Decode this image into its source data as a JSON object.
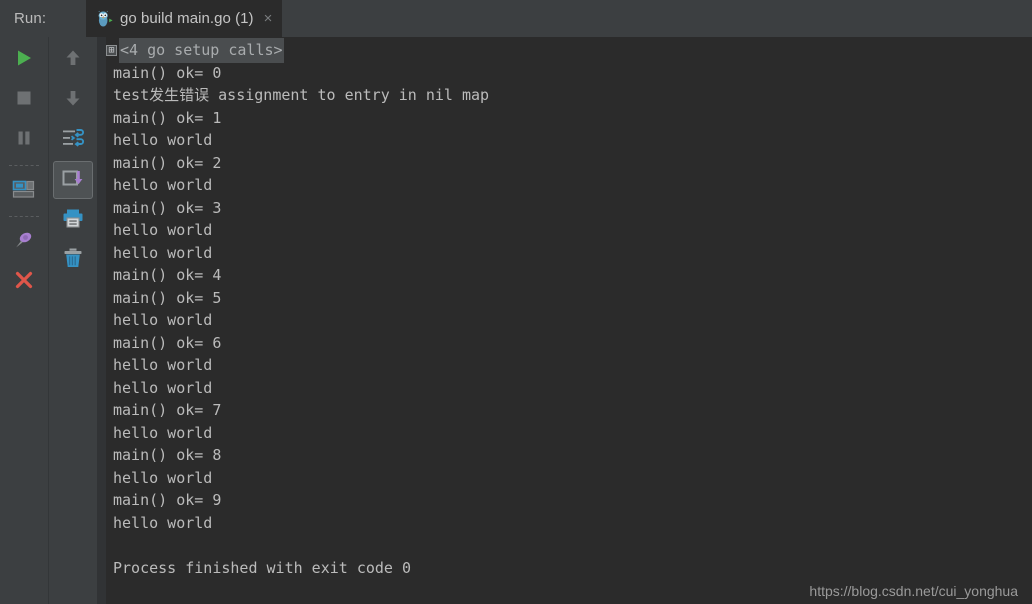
{
  "header": {
    "run_label": "Run:",
    "tab": {
      "title": "go build main.go (1)",
      "icon": "go-gopher-icon",
      "close_label": "×"
    }
  },
  "toolbar_left": [
    {
      "name": "rerun-button",
      "icon": "play-icon",
      "label": "Rerun",
      "color": "#4caf50"
    },
    {
      "name": "stop-button",
      "icon": "stop-square-icon",
      "label": "Stop",
      "color": "#6e7173"
    },
    {
      "name": "pause-button",
      "icon": "pause-icon",
      "label": "Pause Output",
      "color": "#6e7173"
    },
    {
      "name": "layout-settings-button",
      "icon": "layout-panels-icon",
      "label": "Layout Settings",
      "color": "#3592c4"
    },
    {
      "name": "pin-tab-button",
      "icon": "pushpin-icon",
      "label": "Pin Tab",
      "color": "#a87fd0"
    },
    {
      "name": "close-tab-button",
      "icon": "close-x-icon",
      "label": "Close",
      "color": "#e0564a"
    }
  ],
  "toolbar_right": [
    {
      "name": "up-stack-trace-button",
      "icon": "arrow-up-icon",
      "label": "Up the Stack Trace",
      "color": "#6e7173"
    },
    {
      "name": "down-stack-trace-button",
      "icon": "arrow-down-icon",
      "label": "Down the Stack Trace",
      "color": "#6e7173"
    },
    {
      "name": "soft-wrap-button",
      "icon": "soft-wrap-icon",
      "label": "Soft-Wrap",
      "color": "#3592c4"
    },
    {
      "name": "scroll-to-end-button",
      "icon": "scroll-to-end-icon",
      "label": "Scroll to the end",
      "color": "#a87fd0",
      "selected": true
    },
    {
      "name": "print-button",
      "icon": "printer-icon",
      "label": "Print",
      "color": "#3592c4"
    },
    {
      "name": "clear-all-button",
      "icon": "trash-icon",
      "label": "Clear All",
      "color": "#3592c4"
    }
  ],
  "console": {
    "folded_line": {
      "marker": "⊞",
      "text": "<4 go setup calls>"
    },
    "lines": [
      "main() ok= 0",
      "test发生错误 assignment to entry in nil map",
      "main() ok= 1",
      "hello world",
      "main() ok= 2",
      "hello world",
      "main() ok= 3",
      "hello world",
      "hello world",
      "main() ok= 4",
      "main() ok= 5",
      "hello world",
      "main() ok= 6",
      "hello world",
      "hello world",
      "main() ok= 7",
      "hello world",
      "main() ok= 8",
      "hello world",
      "main() ok= 9",
      "hello world",
      "",
      "Process finished with exit code 0"
    ]
  },
  "watermark": {
    "text": "https://blog.csdn.net/cui_yonghua"
  },
  "colors": {
    "window_background": "#2b2b2b",
    "toolbar_background": "#3c3f41",
    "gutter": "#313335",
    "console_text": "#bbbbbb",
    "fold_background": "#4a4d4f",
    "accent_green": "#4caf50",
    "accent_blue": "#3592c4",
    "accent_purple": "#a87fd0",
    "accent_red": "#e0564a"
  }
}
